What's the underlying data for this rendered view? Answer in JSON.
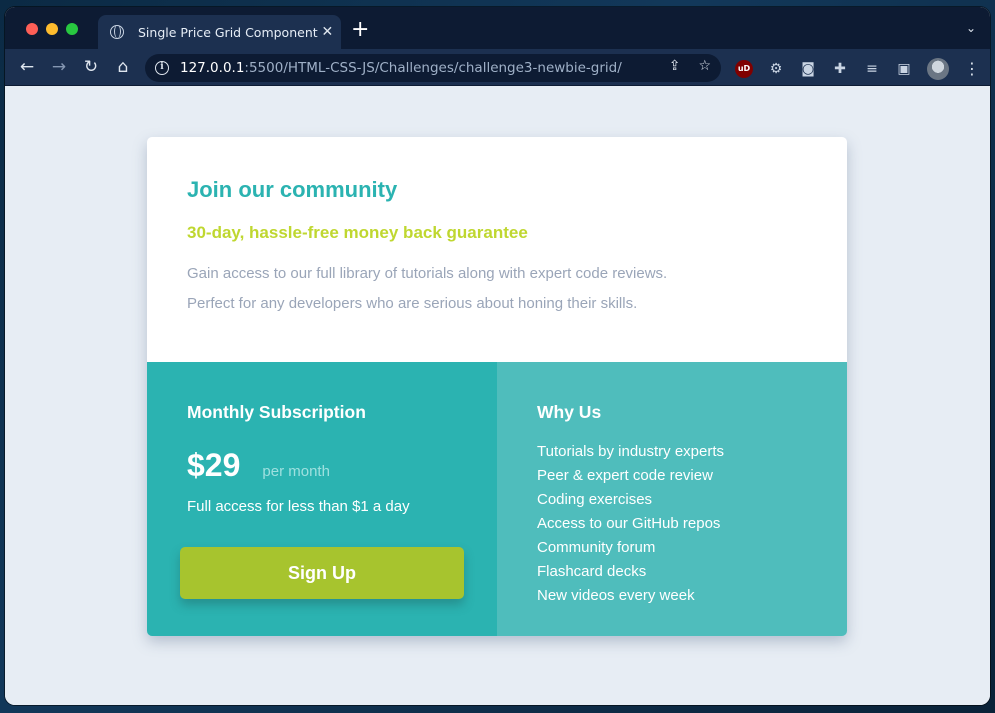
{
  "browser": {
    "tab_title": "Single Price Grid Component",
    "tab_close": "✕",
    "new_tab": "+",
    "tab_menu": "⌄",
    "url_host": "127.0.0.1",
    "url_path": ":5500/HTML-CSS-JS/Challenges/challenge3-newbie-grid/",
    "nav": {
      "back": "←",
      "forward": "→",
      "reload": "↻",
      "home": "⌂"
    },
    "omnibox_icons": [
      "share-icon",
      "bookmark-star-icon"
    ],
    "extensions": [
      "ublock-icon",
      "settings-gear-icon",
      "camera-icon",
      "puzzle-extensions-icon",
      "media-queue-icon",
      "side-panel-icon",
      "profile-avatar-icon",
      "more-menu-icon"
    ],
    "ublock_label": "uD"
  },
  "card": {
    "title": "Join our community",
    "subtitle": "30-day, hassle-free money back guarantee",
    "description_line1": "Gain access to our full library of tutorials along with expert code reviews.",
    "description_line2": "Perfect for any developers who are serious about honing their skills.",
    "subscription": {
      "heading": "Monthly Subscription",
      "price": "$29",
      "period": "per month",
      "note": "Full access for less than $1 a day",
      "button_label": "Sign Up"
    },
    "why_us": {
      "heading": "Why Us",
      "items": [
        "Tutorials by industry experts",
        "Peer & expert code review",
        "Coding exercises",
        "Access to our GitHub repos",
        "Community forum",
        "Flashcard decks",
        "New videos every week"
      ]
    }
  },
  "colors": {
    "accent_cyan": "#2bb3b1",
    "accent_light_cyan": "#4fbdbc",
    "accent_lime": "#bfd730",
    "button_green": "#a7c42e",
    "muted_text": "#9aa5b8"
  }
}
